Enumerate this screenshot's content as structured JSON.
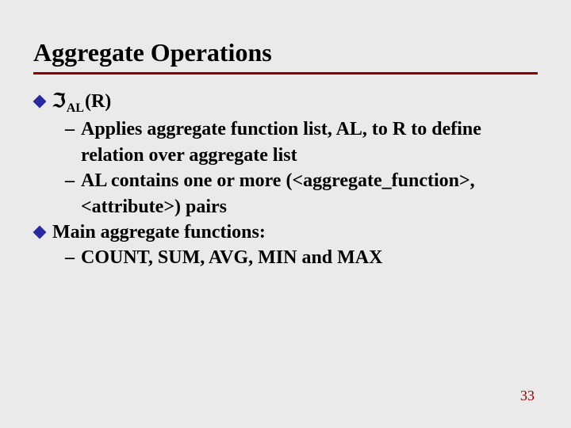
{
  "title": "Aggregate Operations",
  "items": [
    {
      "symbol": "ℑ",
      "subscript": "AL",
      "arg": "(R)",
      "subs": [
        "Applies aggregate function list, AL, to R to define relation over aggregate list",
        "AL contains one or more (<aggregate_function>, <attribute>) pairs"
      ]
    },
    {
      "text": "Main aggregate functions:",
      "subs": [
        "COUNT, SUM, AVG, MIN and MAX"
      ]
    }
  ],
  "page_number": "33"
}
